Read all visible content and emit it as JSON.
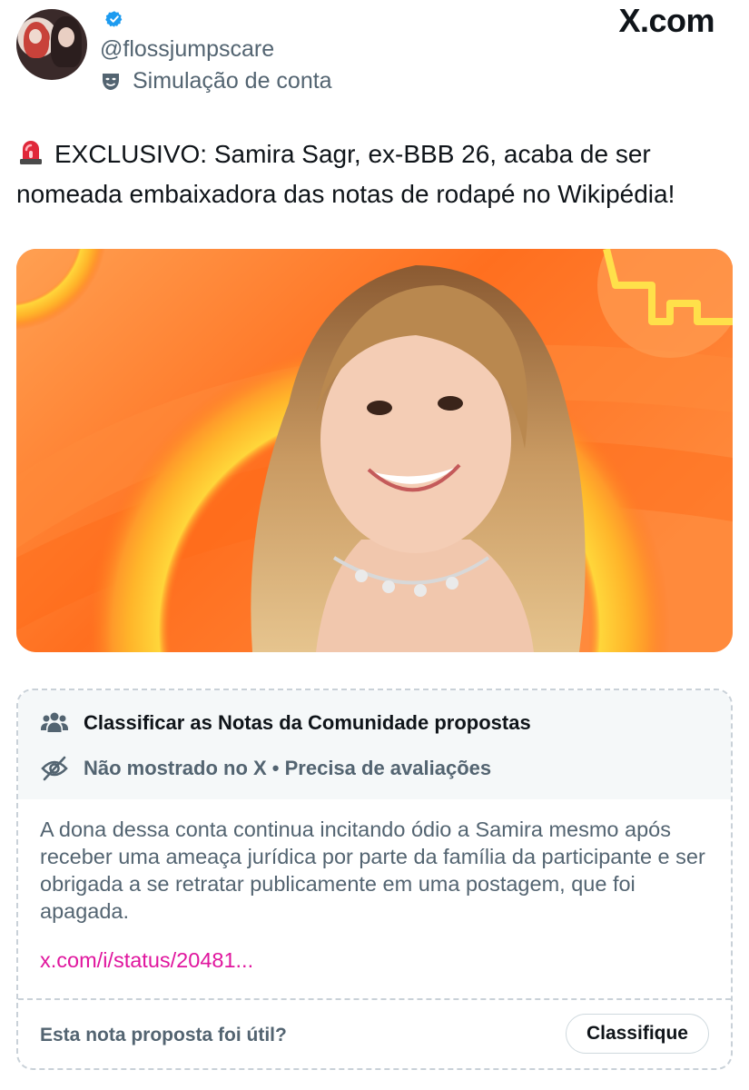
{
  "author": {
    "handle": "@flossjumpscare",
    "label": "Simulação de conta",
    "avatar_icon": "profile-avatar",
    "verified_icon": "verified-badge-icon",
    "label_icon": "theater-mask-icon"
  },
  "brand": {
    "name": "X.com"
  },
  "tweet": {
    "emoji_icon": "police-siren-icon",
    "text": "EXCLUSIVO: Samira Sagr, ex-BBB 26, acaba de ser nomeada embaixadora das notas de rodapé no Wikipédia!"
  },
  "community_note": {
    "title": "Classificar as Notas da Comunidade propostas",
    "status": "Não mostrado no X • Precisa de avaliações",
    "body": "A dona dessa conta continua incitando ódio a Samira mesmo após receber uma ameaça jurídica por parte da família da participante e ser obrigada a se retratar publicamente em uma postagem, que foi apagada.",
    "link": "x.com/i/status/20481...",
    "question": "Esta nota proposta foi útil?",
    "button_label": "Classifique",
    "title_icon": "people-icon",
    "status_icon": "eye-slash-icon"
  },
  "colors": {
    "link": "#e0169e",
    "secondary_text": "#536471",
    "verified": "#1d9bf0",
    "photo_bg": "#ff7a2a"
  }
}
